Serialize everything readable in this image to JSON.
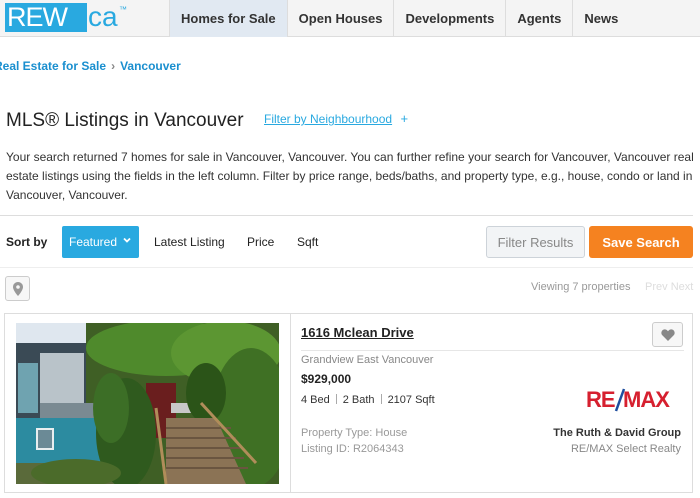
{
  "header": {
    "logo": {
      "primary": "REW",
      "secondary": "ca",
      "mark": "™"
    },
    "nav": [
      "Homes for Sale",
      "Open Houses",
      "Developments",
      "Agents",
      "News"
    ]
  },
  "breadcrumb": {
    "root": "Real Estate for Sale",
    "current": "Vancouver"
  },
  "page": {
    "title": "MLS® Listings in Vancouver",
    "filter_link": "Filter by Neighbourhood",
    "filter_plus": "+",
    "description": "Your search returned 7 homes for sale in Vancouver, Vancouver. You can further refine your search for Vancouver, Vancouver real estate listings using the fields in the left column. Filter by price range, beds/baths, and property type, e.g., house, condo or land in Vancouver, Vancouver."
  },
  "sort": {
    "label": "Sort by",
    "selected": "Featured",
    "options": [
      "Latest Listing",
      "Price",
      "Sqft"
    ],
    "filter_button": "Filter Results",
    "save_button": "Save Search"
  },
  "results": {
    "viewing": "Viewing 7 properties",
    "prev": "Prev",
    "next": "Next"
  },
  "listing": {
    "address": "1616 Mclean Drive",
    "neighbourhood": "Grandview East Vancouver",
    "price": "$929,000",
    "beds": "4 Bed",
    "baths": "2 Bath",
    "sqft": "2107 Sqft",
    "property_type": "Property Type: House",
    "listing_id": "Listing ID: R2064343",
    "agent": "The Ruth & David Group",
    "brokerage": "RE/MAX Select Realty",
    "brand_logo": "RE/MAX"
  },
  "colors": {
    "accent": "#29a9e0",
    "save": "#f58220",
    "remax_red": "#d6202f",
    "remax_blue": "#1d4d9e"
  }
}
